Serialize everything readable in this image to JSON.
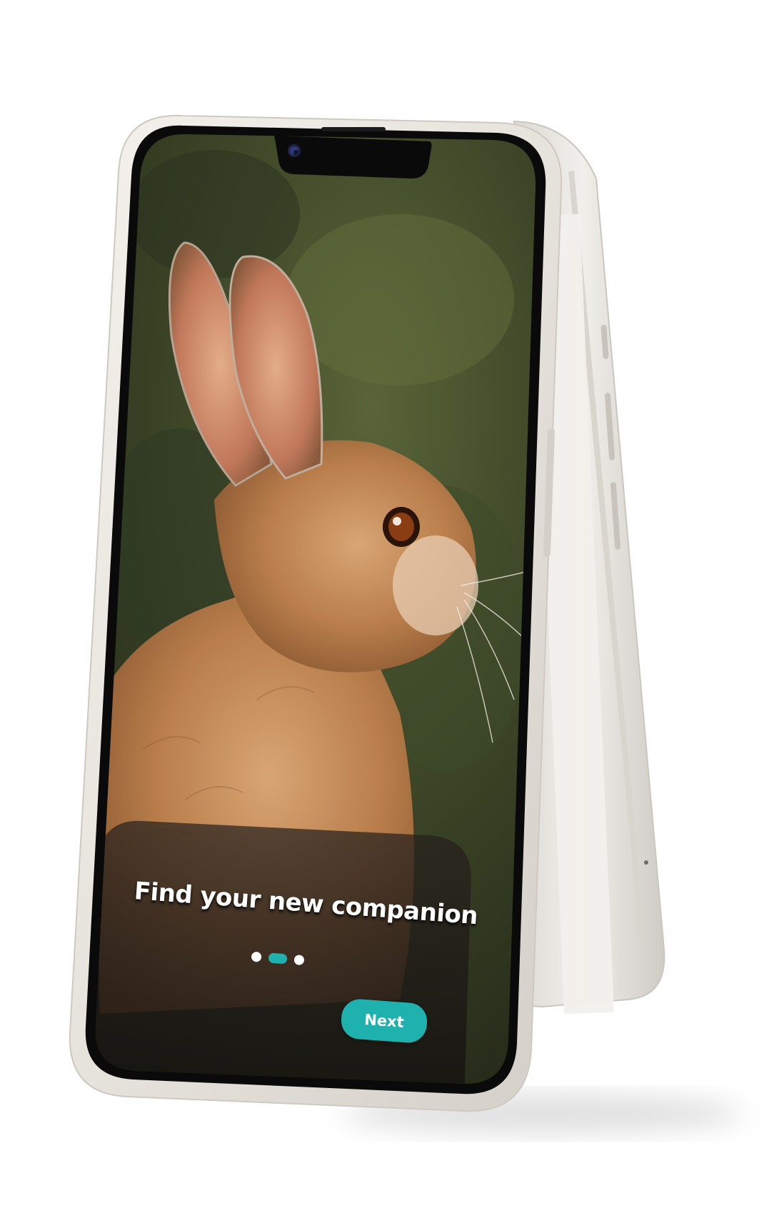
{
  "onboarding": {
    "headline": "Find your new companion",
    "pager": {
      "total": 3,
      "active_index": 1
    },
    "next_label": "Next"
  },
  "colors": {
    "accent": "#1fb1ad",
    "device_frame": "#e9e5df",
    "screen_bezel": "#0a0a0a"
  },
  "icons": {
    "camera": "front-camera-icon"
  }
}
